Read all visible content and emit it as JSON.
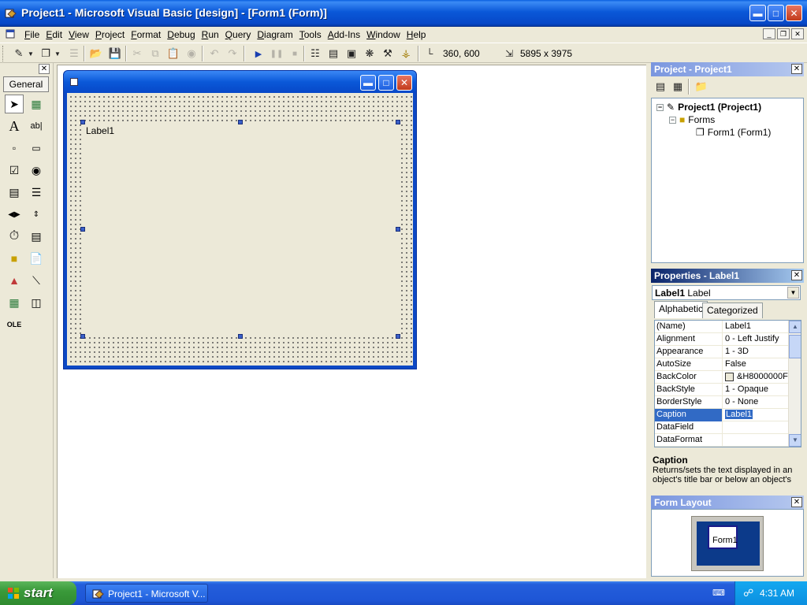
{
  "window": {
    "title": "Project1 - Microsoft Visual Basic [design] - [Form1 (Form)]",
    "controls": [
      "minimize",
      "maximize",
      "close"
    ]
  },
  "menu": {
    "items": [
      "File",
      "Edit",
      "View",
      "Project",
      "Format",
      "Debug",
      "Run",
      "Query",
      "Diagram",
      "Tools",
      "Add-Ins",
      "Window",
      "Help"
    ]
  },
  "toolbar": {
    "position": "360, 600",
    "size": "5895 x 3975"
  },
  "toolbox": {
    "tab": "General",
    "tools": [
      "pointer",
      "picturebox",
      "label",
      "textbox",
      "frame",
      "commandbutton",
      "checkbox",
      "optionbutton",
      "combobox",
      "listbox",
      "hscrollbar",
      "vscrollbar",
      "timer",
      "drivelistbox",
      "dirlistbox",
      "filelistbox",
      "shape",
      "line",
      "image",
      "data",
      "ole"
    ]
  },
  "form_designer": {
    "label_caption": "Label1"
  },
  "project": {
    "title": "Project - Project1",
    "tree": {
      "root": "Project1 (Project1)",
      "folder": "Forms",
      "item": "Form1 (Form1)"
    }
  },
  "properties": {
    "title": "Properties - Label1",
    "object_name": "Label1",
    "object_type": "Label",
    "tabs": [
      "Alphabetic",
      "Categorized"
    ],
    "rows": [
      {
        "name": "(Name)",
        "value": "Label1"
      },
      {
        "name": "Alignment",
        "value": "0 - Left Justify"
      },
      {
        "name": "Appearance",
        "value": "1 - 3D"
      },
      {
        "name": "AutoSize",
        "value": "False"
      },
      {
        "name": "BackColor",
        "value": "&H8000000F"
      },
      {
        "name": "BackStyle",
        "value": "1 - Opaque"
      },
      {
        "name": "BorderStyle",
        "value": "0 - None"
      },
      {
        "name": "Caption",
        "value": "Label1"
      },
      {
        "name": "DataField",
        "value": ""
      },
      {
        "name": "DataFormat",
        "value": ""
      }
    ],
    "selected_row": "Caption",
    "description_title": "Caption",
    "description_text": "Returns/sets the text displayed in an object's title bar or below an object's"
  },
  "form_layout": {
    "title": "Form Layout",
    "form_name": "Form1"
  },
  "taskbar": {
    "start_label": "start",
    "task_label": "Project1 - Microsoft V...",
    "clock": "4:31 AM"
  },
  "colors": {
    "titlebar": "#0a58d8",
    "selection": "#316ac5",
    "taskbar": "#245edb",
    "start": "#3a9a3a"
  }
}
